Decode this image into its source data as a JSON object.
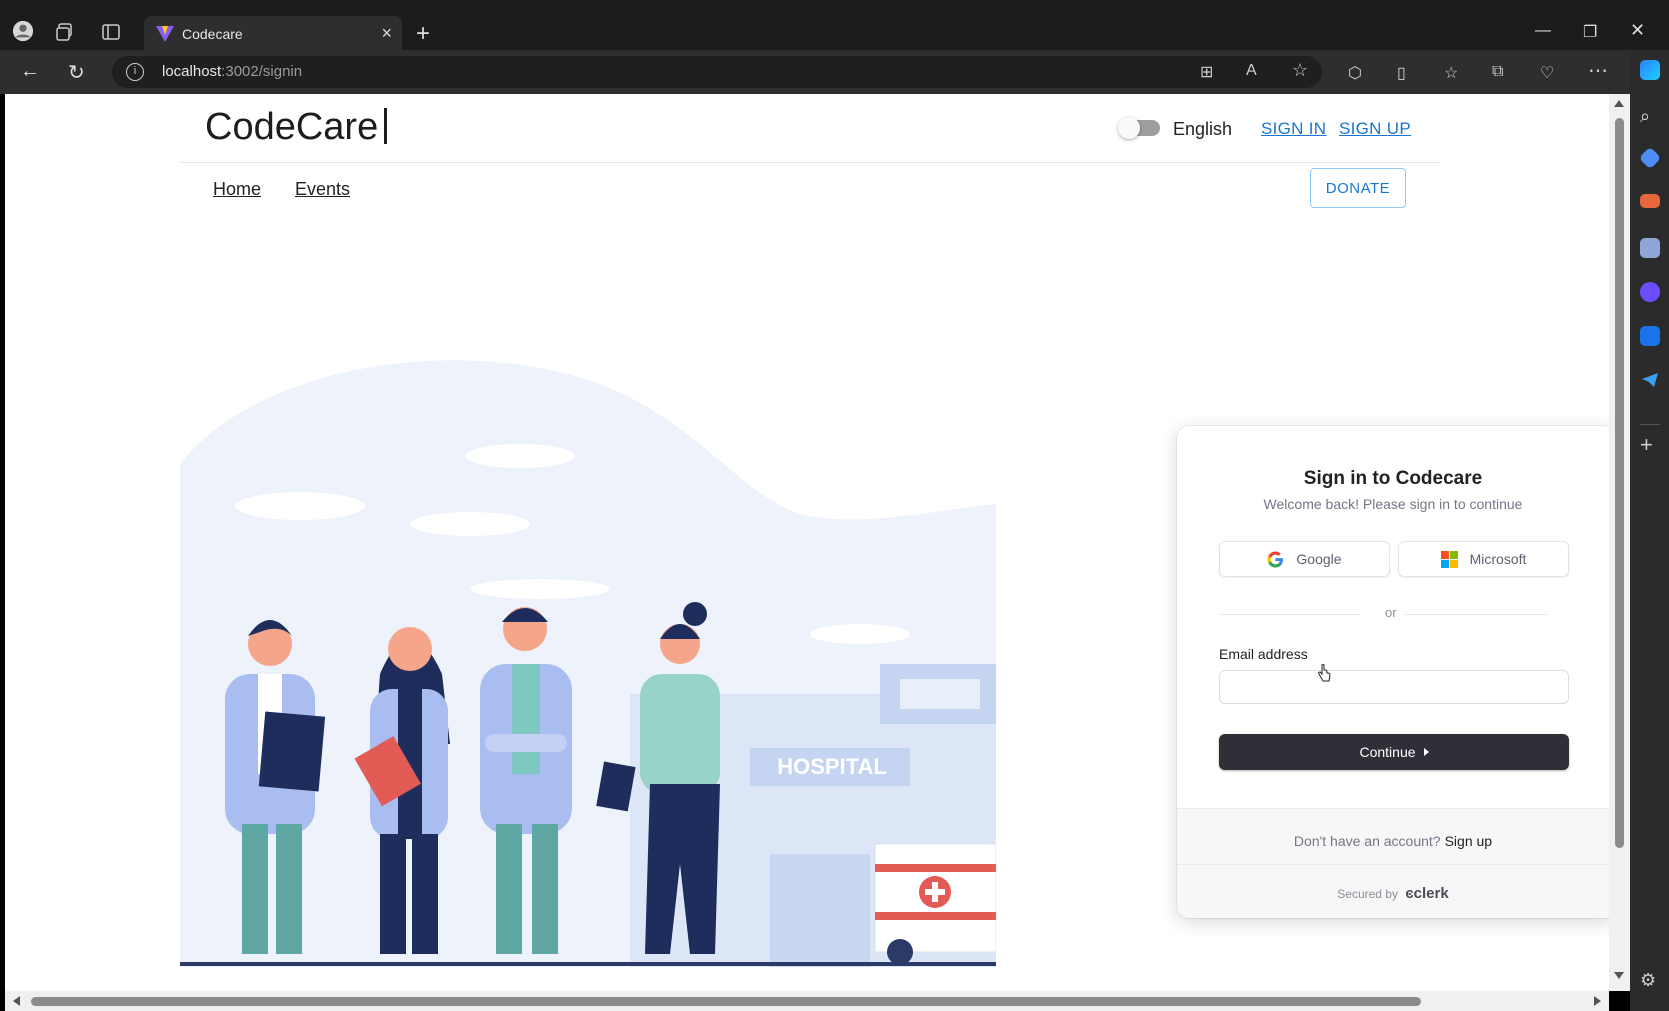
{
  "browser": {
    "tab_title": "Codecare",
    "url_host": "localhost",
    "url_rest": ":3002/signin"
  },
  "header": {
    "logo": "CodeCare",
    "language": "English",
    "sign_in": "SIGN IN",
    "sign_up": "SIGN UP"
  },
  "nav": {
    "home": "Home",
    "events": "Events",
    "donate": "DONATE"
  },
  "illustration": {
    "sign_text": "HOSPITAL"
  },
  "signin_card": {
    "title": "Sign in to Codecare",
    "subtitle": "Welcome back! Please sign in to continue",
    "google": "Google",
    "microsoft": "Microsoft",
    "or": "or",
    "email_label": "Email address",
    "email_value": "",
    "continue": "Continue",
    "no_account": "Don't have an account?",
    "sign_up": "Sign up",
    "secured_by": "Secured by",
    "clerk": "clerk"
  },
  "colors": {
    "link": "#1976d2",
    "button_dark": "#2f3037",
    "browser_bg": "#1c1c1c"
  }
}
